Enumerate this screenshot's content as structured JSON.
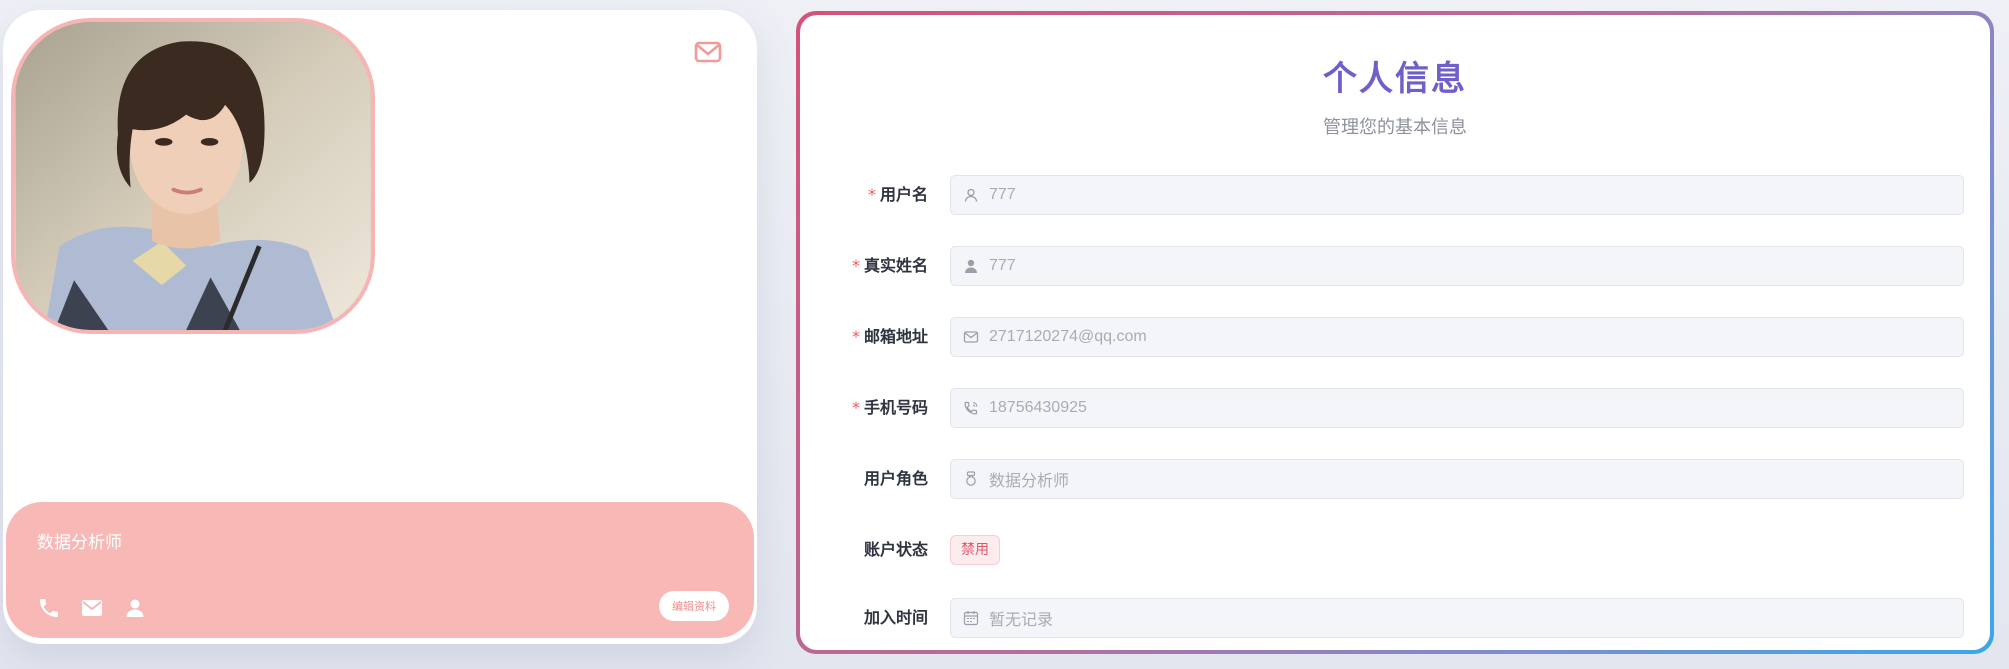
{
  "profile": {
    "role_caption": "数据分析师",
    "edit_button": "编辑资料"
  },
  "info": {
    "title": "个人信息",
    "subtitle": "管理您的基本信息",
    "fields": {
      "username": {
        "label": "用户名",
        "value": "777"
      },
      "realname": {
        "label": "真实姓名",
        "value": "777"
      },
      "email": {
        "label": "邮箱地址",
        "value": "2717120274@qq.com"
      },
      "phone": {
        "label": "手机号码",
        "value": "18756430925"
      },
      "role": {
        "label": "用户角色",
        "value": "数据分析师"
      },
      "status": {
        "label": "账户状态",
        "value": "禁用"
      },
      "joined": {
        "label": "加入时间",
        "value": "暂无记录"
      }
    },
    "required_mark": "*"
  },
  "colors": {
    "accent_title": "#6f5fc9",
    "footer_pink": "#f7b8b6",
    "required": "#f05a5a",
    "status_danger": "#e2566a"
  },
  "icons": {
    "corner": "mail-icon",
    "footer": [
      "phone-icon",
      "mail-icon",
      "user-icon"
    ],
    "fields": [
      "user-outline-icon",
      "user-filled-icon",
      "mail-icon",
      "phone-icon",
      "badge-icon",
      "calendar-icon"
    ]
  }
}
